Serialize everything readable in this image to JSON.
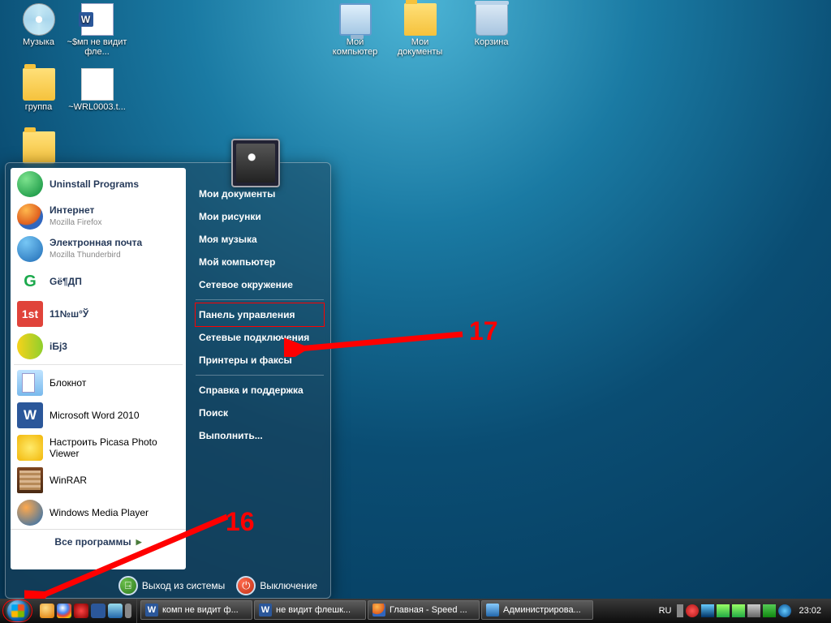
{
  "desktop_icons": {
    "music": "Музыка",
    "smp": "~$мп не видит фле...",
    "group": "группа",
    "wrl": "~WRL0003.t...",
    "mycomp": "Мой компьютер",
    "mydocs": "Мои документы",
    "bin": "Корзина"
  },
  "start_menu": {
    "left": {
      "uninstall": "Uninstall Programs",
      "internet": "Интернет",
      "internet_sub": "Mozilla Firefox",
      "mail": "Электронная почта",
      "mail_sub": "Mozilla Thunderbird",
      "g": "Gё¶ДП",
      "first": "11№ш°Ў",
      "ibj": "іБј3",
      "notepad": "Блокнот",
      "word": "Microsoft Word 2010",
      "picasa": "Настроить Picasa Photo Viewer",
      "winrar": "WinRAR",
      "wmp": "Windows Media Player",
      "allprogs": "Все программы"
    },
    "right": {
      "mydocs": "Мои документы",
      "mypics": "Мои рисунки",
      "mymusic": "Моя музыка",
      "mycomp": "Мой компьютер",
      "netplaces": "Сетевое окружение",
      "cpanel": "Панель управления",
      "netconn": "Сетевые подключения",
      "printers": "Принтеры и факсы",
      "help": "Справка и поддержка",
      "search": "Поиск",
      "run": "Выполнить..."
    },
    "bottom": {
      "logoff": "Выход из системы",
      "shutdown": "Выключение"
    }
  },
  "annotations": {
    "n16": "16",
    "n17": "17"
  },
  "taskbar": {
    "tasks": {
      "t1": "комп не видит ф...",
      "t2": "не видит флешк...",
      "t3": "Главная - Speed ...",
      "t4": "Администрирова..."
    },
    "lang": "RU",
    "clock": "23:02"
  }
}
